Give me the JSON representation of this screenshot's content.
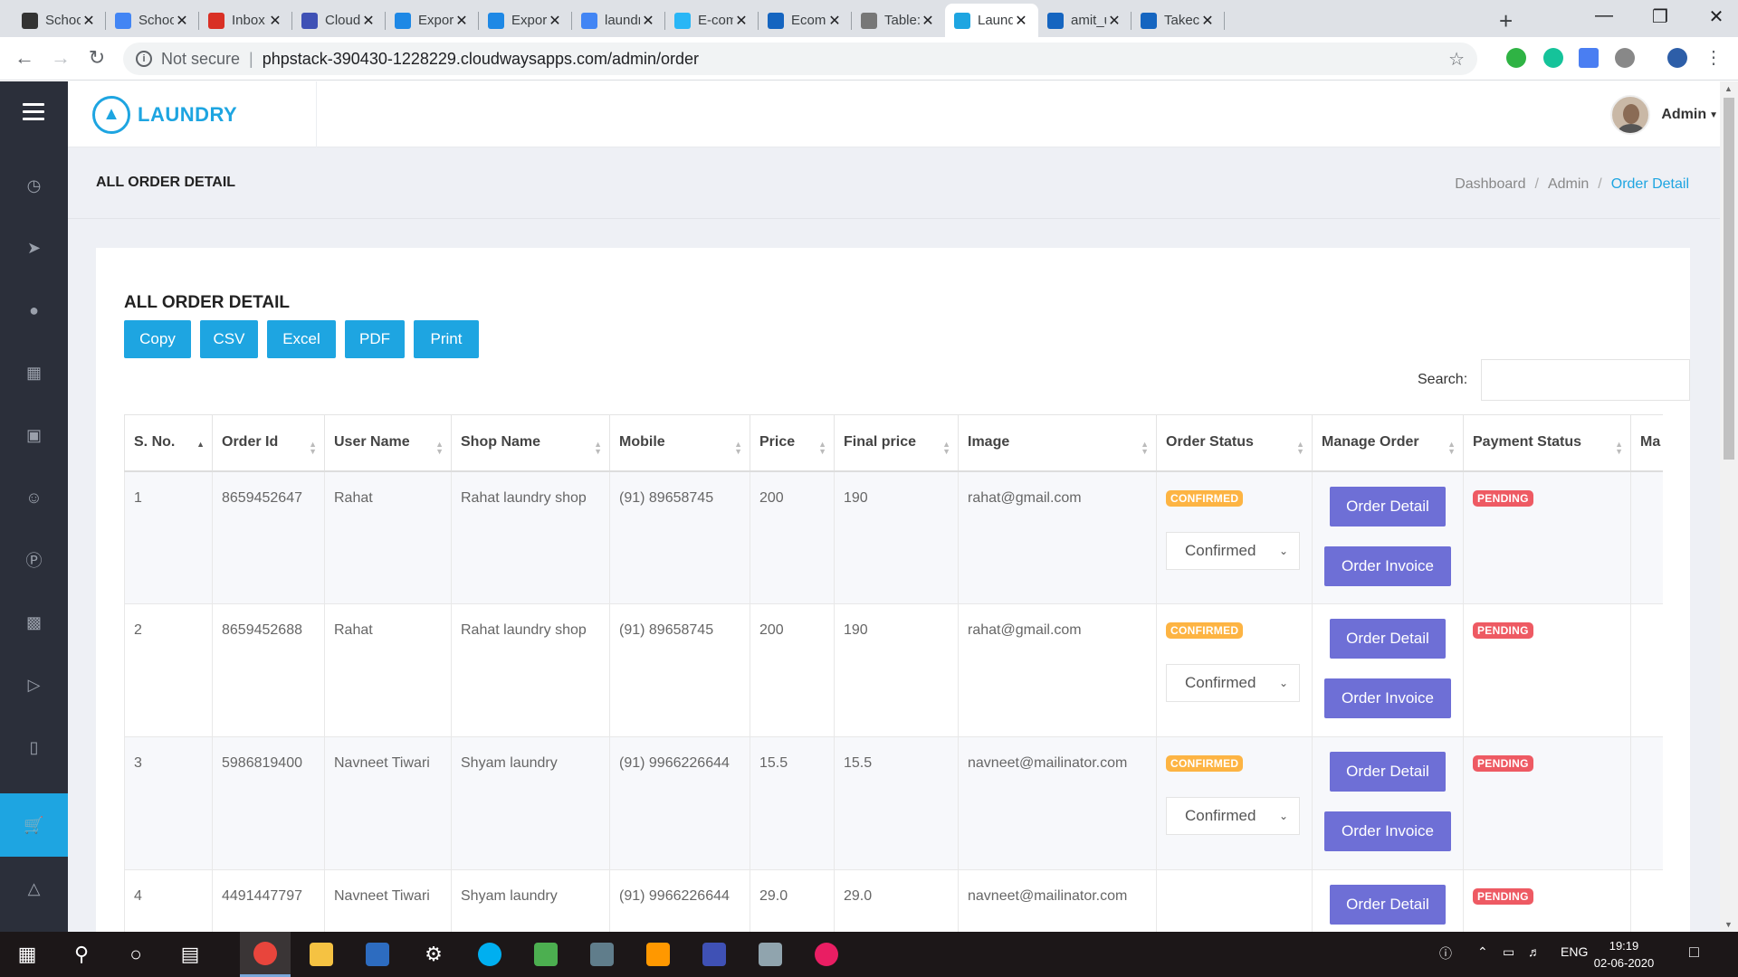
{
  "browser": {
    "tabs": [
      {
        "title": "School",
        "color": "#333333"
      },
      {
        "title": "School",
        "color": "#4285f4"
      },
      {
        "title": "Inbox (",
        "color": "#d93025"
      },
      {
        "title": "Cloudw",
        "color": "#3f51b5"
      },
      {
        "title": "Export",
        "color": "#1e88e5"
      },
      {
        "title": "Export",
        "color": "#1e88e5"
      },
      {
        "title": "laundr",
        "color": "#4285f4"
      },
      {
        "title": "E-com",
        "color": "#29b6f6"
      },
      {
        "title": "Ecomn",
        "color": "#1565c0"
      },
      {
        "title": "Table:",
        "color": "#777777"
      },
      {
        "title": "Laund",
        "color": "#1ea5e1"
      },
      {
        "title": "amit_u",
        "color": "#1565c0"
      },
      {
        "title": "Takeca",
        "color": "#1565c0"
      }
    ],
    "not_secure": "Not secure",
    "url": "phpstack-390430-1228229.cloudwaysapps.com/admin/order"
  },
  "app": {
    "brand": "LAUNDRY",
    "user_name": "Admin",
    "page_title": "ALL ORDER DETAIL",
    "breadcrumb": [
      "Dashboard",
      "Admin",
      "Order Detail"
    ],
    "card_title": "ALL ORDER DETAIL",
    "export_buttons": [
      "Copy",
      "CSV",
      "Excel",
      "PDF",
      "Print"
    ],
    "search_label": "Search:",
    "columns": [
      "S. No.",
      "Order Id",
      "User Name",
      "Shop Name",
      "Mobile",
      "Price",
      "Final price",
      "Image",
      "Order Status",
      "Manage Order",
      "Payment Status",
      "Ma"
    ],
    "rows": [
      {
        "sno": "1",
        "order_id": "8659452647",
        "user": "Rahat",
        "shop": "Rahat laundry shop",
        "mobile": "(91) 89658745",
        "price": "200",
        "final": "190",
        "image": "rahat@gmail.com",
        "status_badge": "CONFIRMED",
        "status_select": "Confirmed",
        "detail": "Order Detail",
        "invoice": "Order Invoice",
        "payment": "PENDING"
      },
      {
        "sno": "2",
        "order_id": "8659452688",
        "user": "Rahat",
        "shop": "Rahat laundry shop",
        "mobile": "(91) 89658745",
        "price": "200",
        "final": "190",
        "image": "rahat@gmail.com",
        "status_badge": "CONFIRMED",
        "status_select": "Confirmed",
        "detail": "Order Detail",
        "invoice": "Order Invoice",
        "payment": "PENDING"
      },
      {
        "sno": "3",
        "order_id": "5986819400",
        "user": "Navneet Tiwari",
        "shop": "Shyam laundry",
        "mobile": "(91) 9966226644",
        "price": "15.5",
        "final": "15.5",
        "image": "navneet@mailinator.com",
        "status_badge": "CONFIRMED",
        "status_select": "Confirmed",
        "detail": "Order Detail",
        "invoice": "Order Invoice",
        "payment": "PENDING"
      },
      {
        "sno": "4",
        "order_id": "4491447797",
        "user": "Navneet Tiwari",
        "shop": "Shyam laundry",
        "mobile": "(91) 9966226644",
        "price": "29.0",
        "final": "29.0",
        "image": "navneet@mailinator.com",
        "status_badge": "",
        "status_select": "",
        "detail": "Order Detail",
        "invoice": "",
        "payment": "PENDING"
      }
    ]
  },
  "taskbar": {
    "language": "ENG",
    "time": "19:19",
    "date": "02-06-2020"
  },
  "colors": {
    "accent": "#1ea5e1",
    "primary_button": "#6e6fd6",
    "badge_confirmed": "#fdb443",
    "badge_pending": "#ee5a63",
    "sidebar": "#2b2f3a"
  }
}
